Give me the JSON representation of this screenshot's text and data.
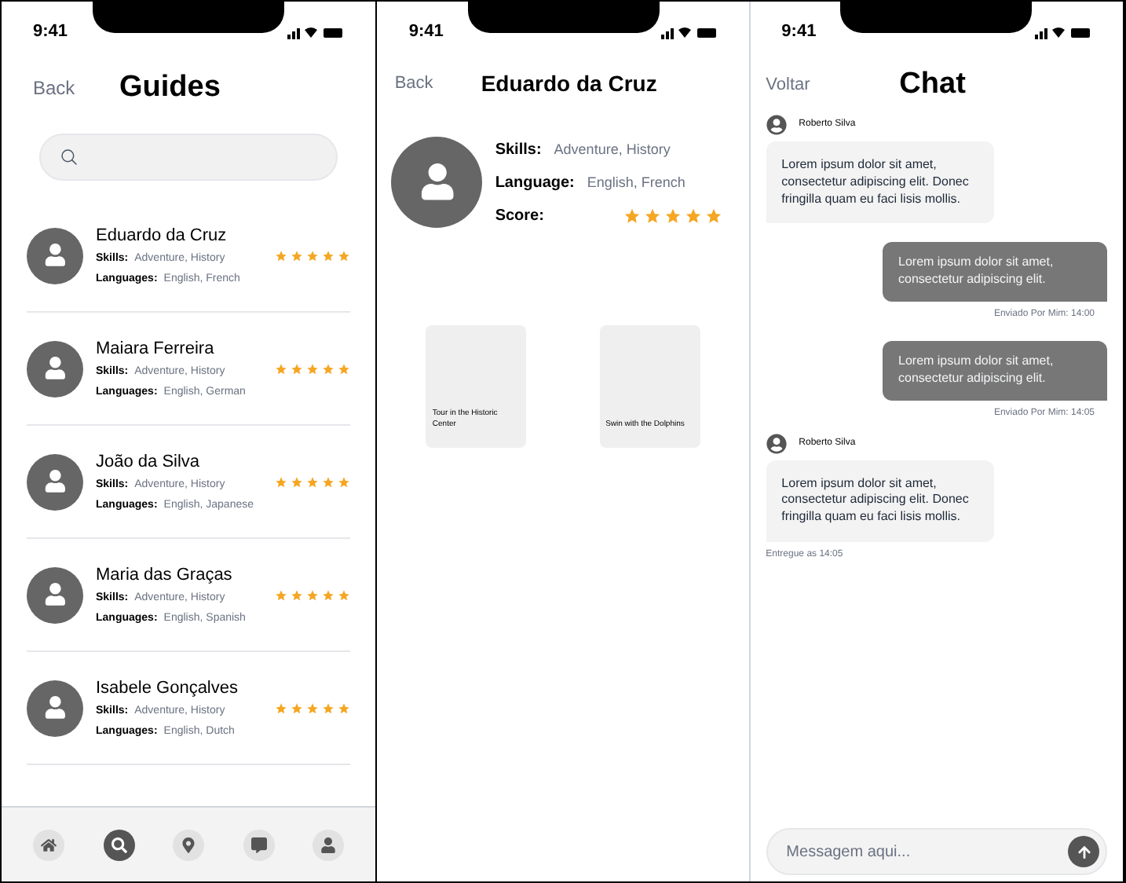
{
  "guides_screen": {
    "status_time": "9:41",
    "back": "Back",
    "title": "Guides",
    "guides": [
      {
        "name": "Eduardo da Cruz",
        "skills_label": "Skills:",
        "skills": "Adventure, History",
        "languages_label": "Languages:",
        "languages": "English, French",
        "stars": 5
      },
      {
        "name": "Maiara Ferreira",
        "skills_label": "Skills:",
        "skills": "Adventure, History",
        "languages_label": "Languages:",
        "languages": "English, German",
        "stars": 5
      },
      {
        "name": "João da Silva",
        "skills_label": "Skills:",
        "skills": "Adventure, History",
        "languages_label": "Languages:",
        "languages": "English, Japanese",
        "stars": 5
      },
      {
        "name": "Maria das Graças",
        "skills_label": "Skills:",
        "skills": "Adventure, History",
        "languages_label": "Languages:",
        "languages": "English, Spanish",
        "stars": 5
      },
      {
        "name": "Isabele Gonçalves",
        "skills_label": "Skills:",
        "skills": "Adventure, History",
        "languages_label": "Languages:",
        "languages": "English, Dutch",
        "stars": 5
      }
    ],
    "nav": [
      {
        "kind": "home",
        "selected": false
      },
      {
        "kind": "search",
        "selected": true
      },
      {
        "kind": "map",
        "selected": false
      },
      {
        "kind": "chat",
        "selected": false
      },
      {
        "kind": "profile",
        "selected": false
      }
    ]
  },
  "profile_screen": {
    "status_time": "9:41",
    "back": "Back",
    "title": "Eduardo da Cruz",
    "fields": [
      {
        "label": "Skills:",
        "value": "Adventure, History"
      },
      {
        "label": "Language:",
        "value": "English, French"
      }
    ],
    "score_label": "Score:",
    "stars": 5,
    "tours": [
      "Tour in the Historic Center",
      "Swin with the Dolphins"
    ]
  },
  "chat_screen": {
    "status_time": "9:41",
    "back": "Voltar",
    "title": "Chat",
    "messages": [
      {
        "kind": "received",
        "sender": "Roberto Silva",
        "text": "Lorem ipsum dolor sit amet, consectetur adipiscing elit. Donec fringilla quam eu faci lisis mollis."
      },
      {
        "kind": "sent",
        "text": "Lorem ipsum dolor sit amet, consectetur adipiscing elit.",
        "meta": "Enviado Por Mim: 14:00"
      },
      {
        "kind": "sent",
        "text": "Lorem ipsum dolor sit amet, consectetur adipiscing elit.",
        "meta": "Enviado Por Mim: 14:05"
      },
      {
        "kind": "received",
        "sender": "Roberto Silva",
        "text": "Lorem ipsum dolor sit amet, consectetur adipiscing elit. Donec fringilla quam eu faci lisis mollis.",
        "meta": "Entregue as 14:05"
      }
    ],
    "input": {
      "placeholder": "Messagem aqui..."
    }
  }
}
